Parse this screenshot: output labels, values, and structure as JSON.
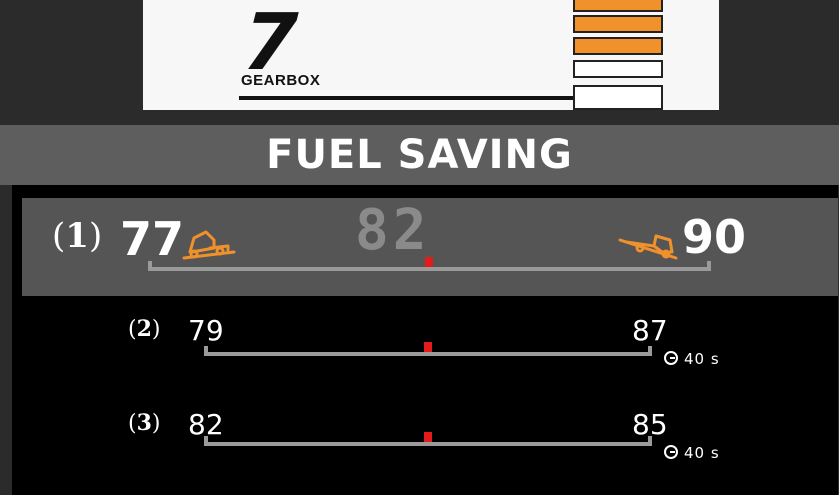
{
  "gearbox": {
    "gear": "7",
    "label": "GEARBOX",
    "levels": [
      true,
      true,
      true,
      false,
      false
    ]
  },
  "title": "FUEL SAVING",
  "current_value": "82",
  "rows": [
    {
      "rank": "1",
      "min": "77",
      "max": "90",
      "timer": ""
    },
    {
      "rank": "2",
      "min": "79",
      "max": "87",
      "timer": "40 s"
    },
    {
      "rank": "3",
      "min": "82",
      "max": "85",
      "timer": "40 s"
    }
  ],
  "colors": {
    "accent": "#f0912c",
    "marker": "#e31b1b",
    "bar": "#9a9a9a"
  }
}
